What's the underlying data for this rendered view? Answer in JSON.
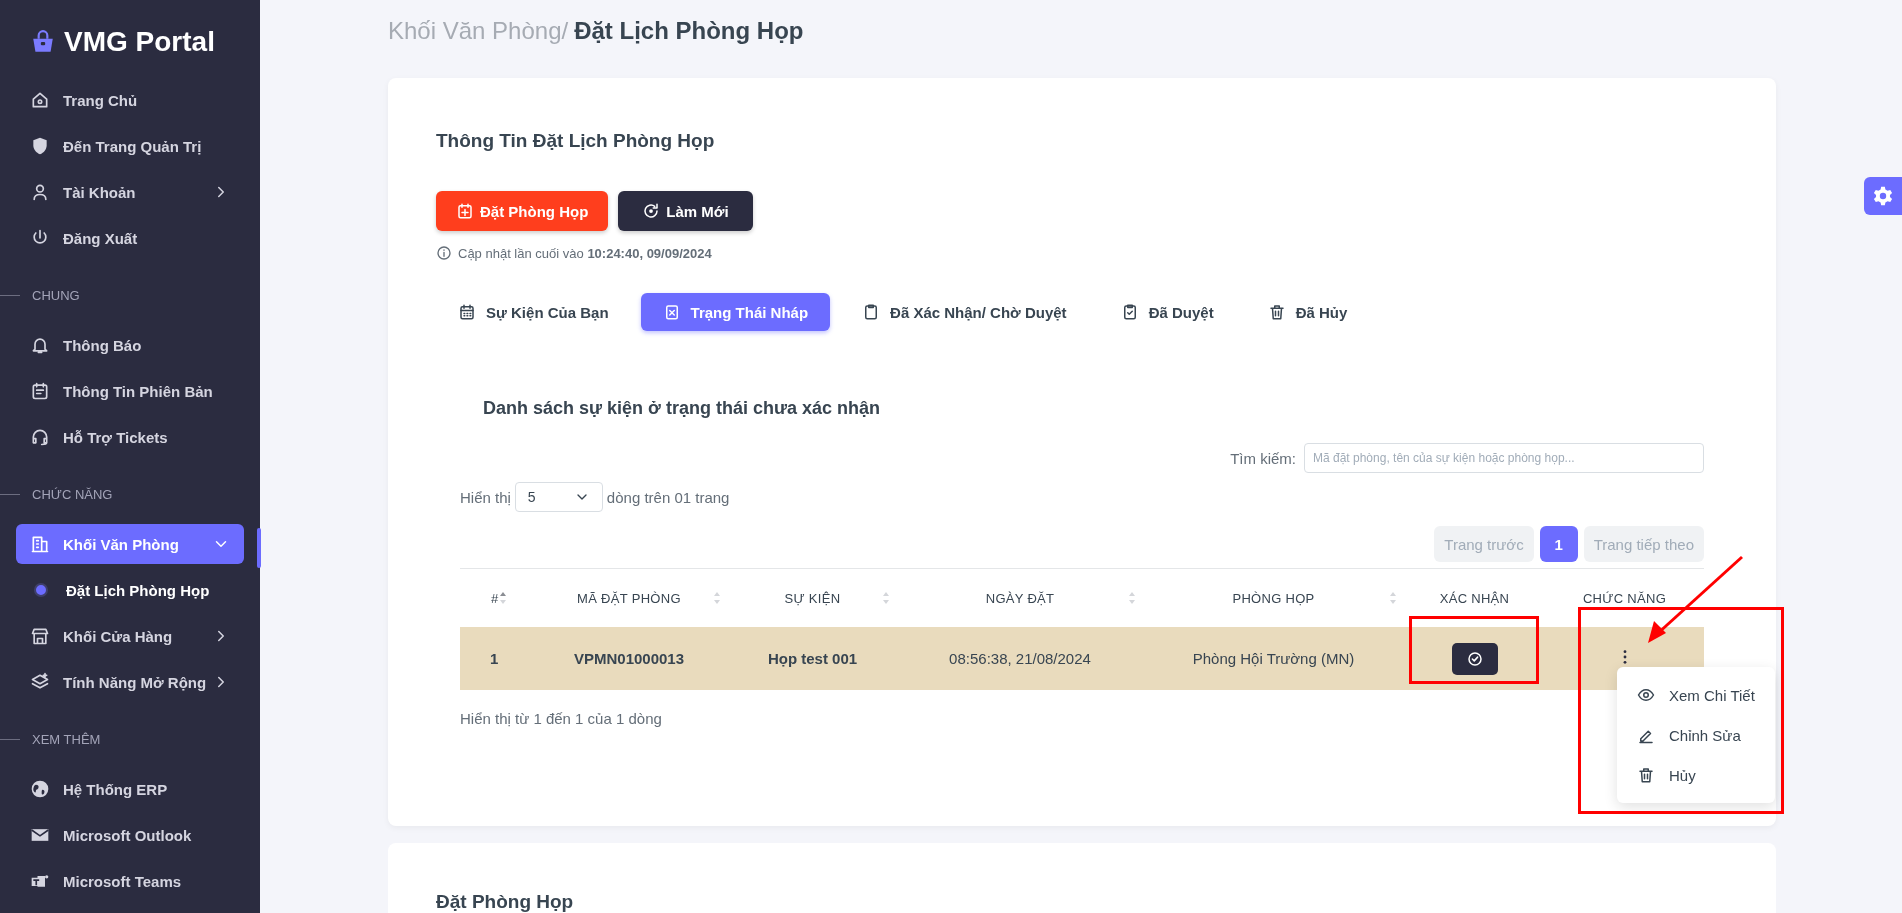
{
  "sidebar": {
    "logo": "VMG Portal",
    "items": [
      {
        "kind": "item",
        "label": "Trang Chủ",
        "selected": false
      },
      {
        "kind": "item",
        "label": "Đến Trang Quản Trị",
        "selected": false
      },
      {
        "kind": "item",
        "label": "Tài Khoản",
        "selected": false,
        "expanded": false
      },
      {
        "kind": "item",
        "label": "Đăng Xuất",
        "selected": false
      },
      {
        "kind": "section",
        "label": "CHUNG"
      },
      {
        "kind": "item",
        "label": "Thông Báo",
        "selected": false
      },
      {
        "kind": "item",
        "label": "Thông Tin Phiên Bản",
        "selected": false
      },
      {
        "kind": "item",
        "label": "Hỗ Trợ Tickets",
        "selected": false
      },
      {
        "kind": "section",
        "label": "CHỨC NĂNG"
      },
      {
        "kind": "item",
        "label": "Khối Văn Phòng",
        "selected": true,
        "expanded": true
      },
      {
        "kind": "subitem",
        "label": "Đặt Lịch Phòng Họp",
        "selected": true
      },
      {
        "kind": "item",
        "label": "Khối Cửa Hàng",
        "selected": false,
        "expanded": false
      },
      {
        "kind": "item",
        "label": "Tính Năng Mở Rộng",
        "selected": false,
        "expanded": false
      },
      {
        "kind": "section",
        "label": "XEM THÊM"
      },
      {
        "kind": "item",
        "label": "Hệ Thống ERP",
        "selected": false
      },
      {
        "kind": "item",
        "label": "Microsoft Outlook",
        "selected": false
      },
      {
        "kind": "item",
        "label": "Microsoft Teams",
        "selected": false
      }
    ]
  },
  "breadcrumb": {
    "parent": "Khối Văn Phòng/",
    "current": "Đặt Lịch Phòng Họp"
  },
  "card": {
    "title": "Thông Tin Đặt Lịch Phòng Họp",
    "buttons": [
      {
        "kind": "primary",
        "label": "Đặt Phòng Họp"
      },
      {
        "kind": "dark",
        "label": "Làm Mới"
      }
    ],
    "updated": "Cập nhật lần cuối vào **10:24:40, 09/09/2024**",
    "tabs": [
      {
        "label": "Sự Kiện Của Bạn",
        "selected": false
      },
      {
        "label": "Trạng Thái Nháp",
        "selected": true
      },
      {
        "label": "Đã Xác Nhận/ Chờ Duyệt",
        "selected": false
      },
      {
        "label": "Đã Duyệt",
        "selected": false
      },
      {
        "label": "Đã Hủy",
        "selected": false
      }
    ],
    "list_title": "Danh sách sự kiện ở trạng thái chưa xác nhận",
    "search": {
      "label": "Tìm kiếm:",
      "placeholder": "Mã đặt phòng, tên của sự kiện hoặc phòng họp..."
    },
    "page_size": {
      "before": "Hiển thị",
      "value": "5",
      "after": "dòng trên 01 trang"
    },
    "pagination": [
      {
        "label": "Trang trước",
        "selected": false,
        "disabled": true
      },
      {
        "label": "1",
        "selected": true,
        "disabled": false
      },
      {
        "label": "Trang tiếp theo",
        "selected": false,
        "disabled": true
      }
    ],
    "table": {
      "columns": [
        {
          "label": "#",
          "sortable": true
        },
        {
          "label": "MÃ ĐẶT PHÒNG",
          "sortable": true
        },
        {
          "label": "SỰ KIỆN",
          "sortable": true
        },
        {
          "label": "NGÀY ĐẶT",
          "sortable": true
        },
        {
          "label": "PHÒNG HỌP",
          "sortable": true
        },
        {
          "label": "XÁC NHẬN",
          "sortable": false
        },
        {
          "label": "CHỨC NĂNG",
          "sortable": false
        }
      ],
      "rows": [
        {
          "cells": [
            "1",
            "VPMN01000013",
            "Họp test 001",
            "08:56:38, 21/08/2024",
            "Phòng Hội Trường (MN)"
          ],
          "selected": true
        }
      ]
    },
    "footer": "Hiển thị từ 1 đến 1 của 1 dòng",
    "menu": [
      {
        "label": "Xem Chi Tiết"
      },
      {
        "label": "Chỉnh Sửa"
      },
      {
        "label": "Hủy"
      }
    ]
  },
  "second_card": {
    "title": "Đặt Phòng Họp"
  }
}
